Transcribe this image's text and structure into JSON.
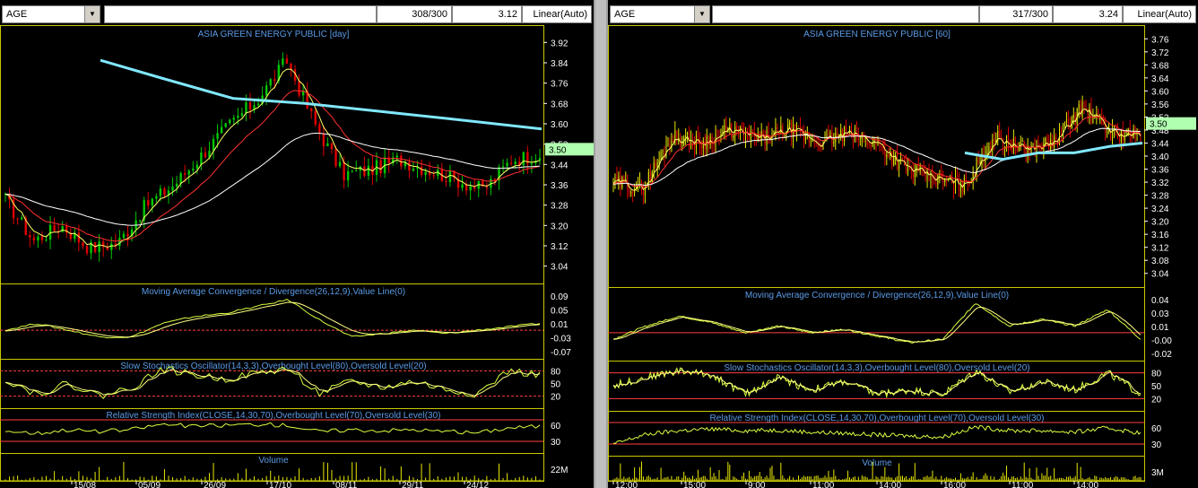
{
  "left": {
    "symbol": "AGE",
    "count": "308/300",
    "price": "3.12",
    "scale": "Linear(Auto)",
    "title": "ASIA GREEN ENERGY PUBLIC [day]",
    "price_ticks": [
      "3.92",
      "3.84",
      "3.76",
      "3.68",
      "3.60",
      "3.52",
      "3.44",
      "3.36",
      "3.28",
      "3.20",
      "3.12",
      "3.04"
    ],
    "last_price": "3.50",
    "macd_title": "Moving Average Convergence / Divergence(26,12,9),Value Line(0)",
    "macd_ticks": [
      "0.09",
      "0.05",
      "0.01",
      "-0.03",
      "-0.07"
    ],
    "stoch_title": "Slow Stochastics Oscillator(14,3,3),Overbought Level(80),Oversold Level(20)",
    "stoch_ticks": [
      "80",
      "50",
      "20"
    ],
    "rsi_title": "Relative Strength Index(CLOSE,14,30,70),Overbought Level(70),Oversold Level(30)",
    "rsi_ticks": [
      "60",
      "30"
    ],
    "volume_title": "Volume",
    "volume_tick": "22M",
    "date_ticks": [
      "15/08",
      "05/09",
      "26/09",
      "17/10",
      "08/11",
      "29/11",
      "24/12"
    ]
  },
  "right": {
    "symbol": "AGE",
    "count": "317/300",
    "price": "3.24",
    "scale": "Linear(Auto)",
    "title": "ASIA GREEN ENERGY PUBLIC [60]",
    "price_ticks": [
      "3.76",
      "3.72",
      "3.68",
      "3.64",
      "3.60",
      "3.56",
      "3.52",
      "3.48",
      "3.44",
      "3.40",
      "3.36",
      "3.32",
      "3.28",
      "3.24",
      "3.20",
      "3.16",
      "3.12",
      "3.08",
      "3.04"
    ],
    "last_price": "3.50",
    "macd_title": "Moving Average Convergence / Divergence(26,12,9),Value Line(0)",
    "macd_ticks": [
      "0.04",
      "0.03",
      "0.01",
      "-0.00",
      "-0.02"
    ],
    "stoch_title": "Slow Stochastics Oscillator(14,3,3),Overbought Level(80),Oversold Level(20)",
    "stoch_ticks": [
      "80",
      "50",
      "20"
    ],
    "rsi_title": "Relative Strength Index(CLOSE,14,30,70),Overbought Level(70),Oversold Level(30)",
    "rsi_ticks": [
      "60",
      "30"
    ],
    "volume_title": "Volume",
    "volume_tick": "3M",
    "time_ticks": [
      "12:00",
      "15:00",
      "9:00",
      "11:00",
      "14:00",
      "16:00",
      "11:00",
      "14:00"
    ]
  },
  "colors": {
    "panel_border": "#c8c800",
    "title_blue": "#5a9be6",
    "up_candle": "#00c800",
    "down_candle": "#e00000",
    "long_ma": "#80e8ff",
    "last_price_bg": "#b0ffb0"
  }
}
